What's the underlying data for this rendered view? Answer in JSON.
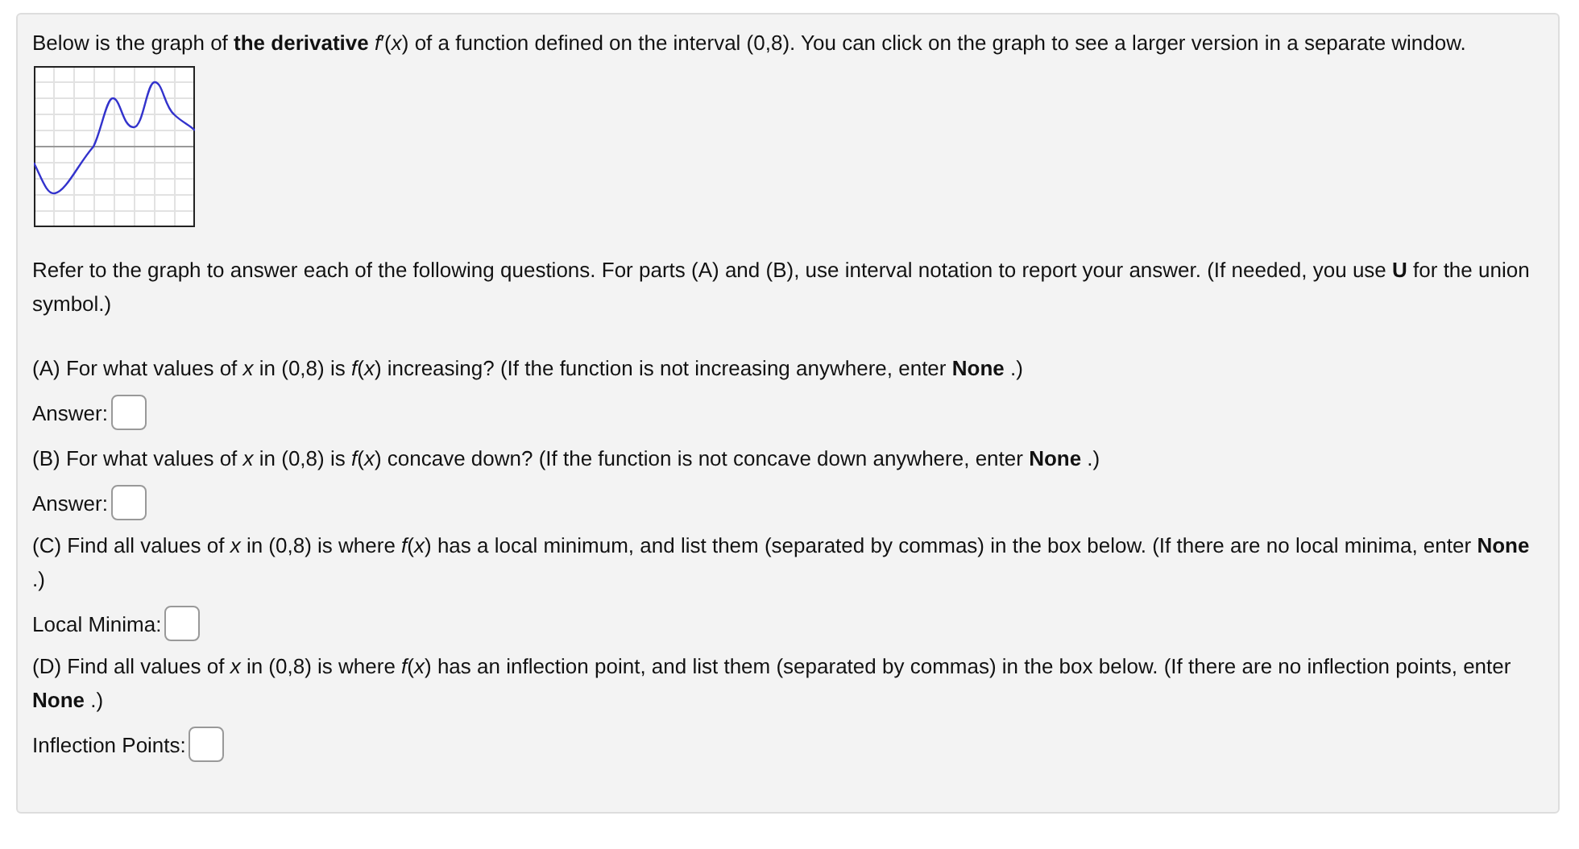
{
  "intro": "Below is the graph of **the derivative** *f*′(*x*) of a function defined on the interval (0,8). You can click on the graph to see a larger version in a separate window.",
  "instructions": "Refer to the graph to answer each of the following questions. For parts (A) and (B), use interval notation to report your answer. (If needed, you use **U** for the union symbol.)",
  "questions": [
    {
      "text": "(A) For what values of *x* in (0,8) is *f*(*x*) increasing? (If the function is not increasing anywhere, enter **None** .)",
      "answer_label": "Answer:"
    },
    {
      "text": "(B) For what values of *x* in (0,8) is *f*(*x*) concave down? (If the function is not concave down anywhere, enter **None** .)",
      "answer_label": "Answer:"
    },
    {
      "text": "(C) Find all values of *x* in (0,8) is where *f*(*x*) has a local minimum, and list them (separated by commas) in the box below. (If there are no local minima, enter **None** .)",
      "answer_label": "Local Minima:"
    },
    {
      "text": "(D) Find all values of *x* in (0,8) is where *f*(*x*) has an inflection point, and list them (separated by commas) in the box below. (If there are no inflection points, enter **None** .)",
      "answer_label": "Inflection Points:"
    }
  ]
}
